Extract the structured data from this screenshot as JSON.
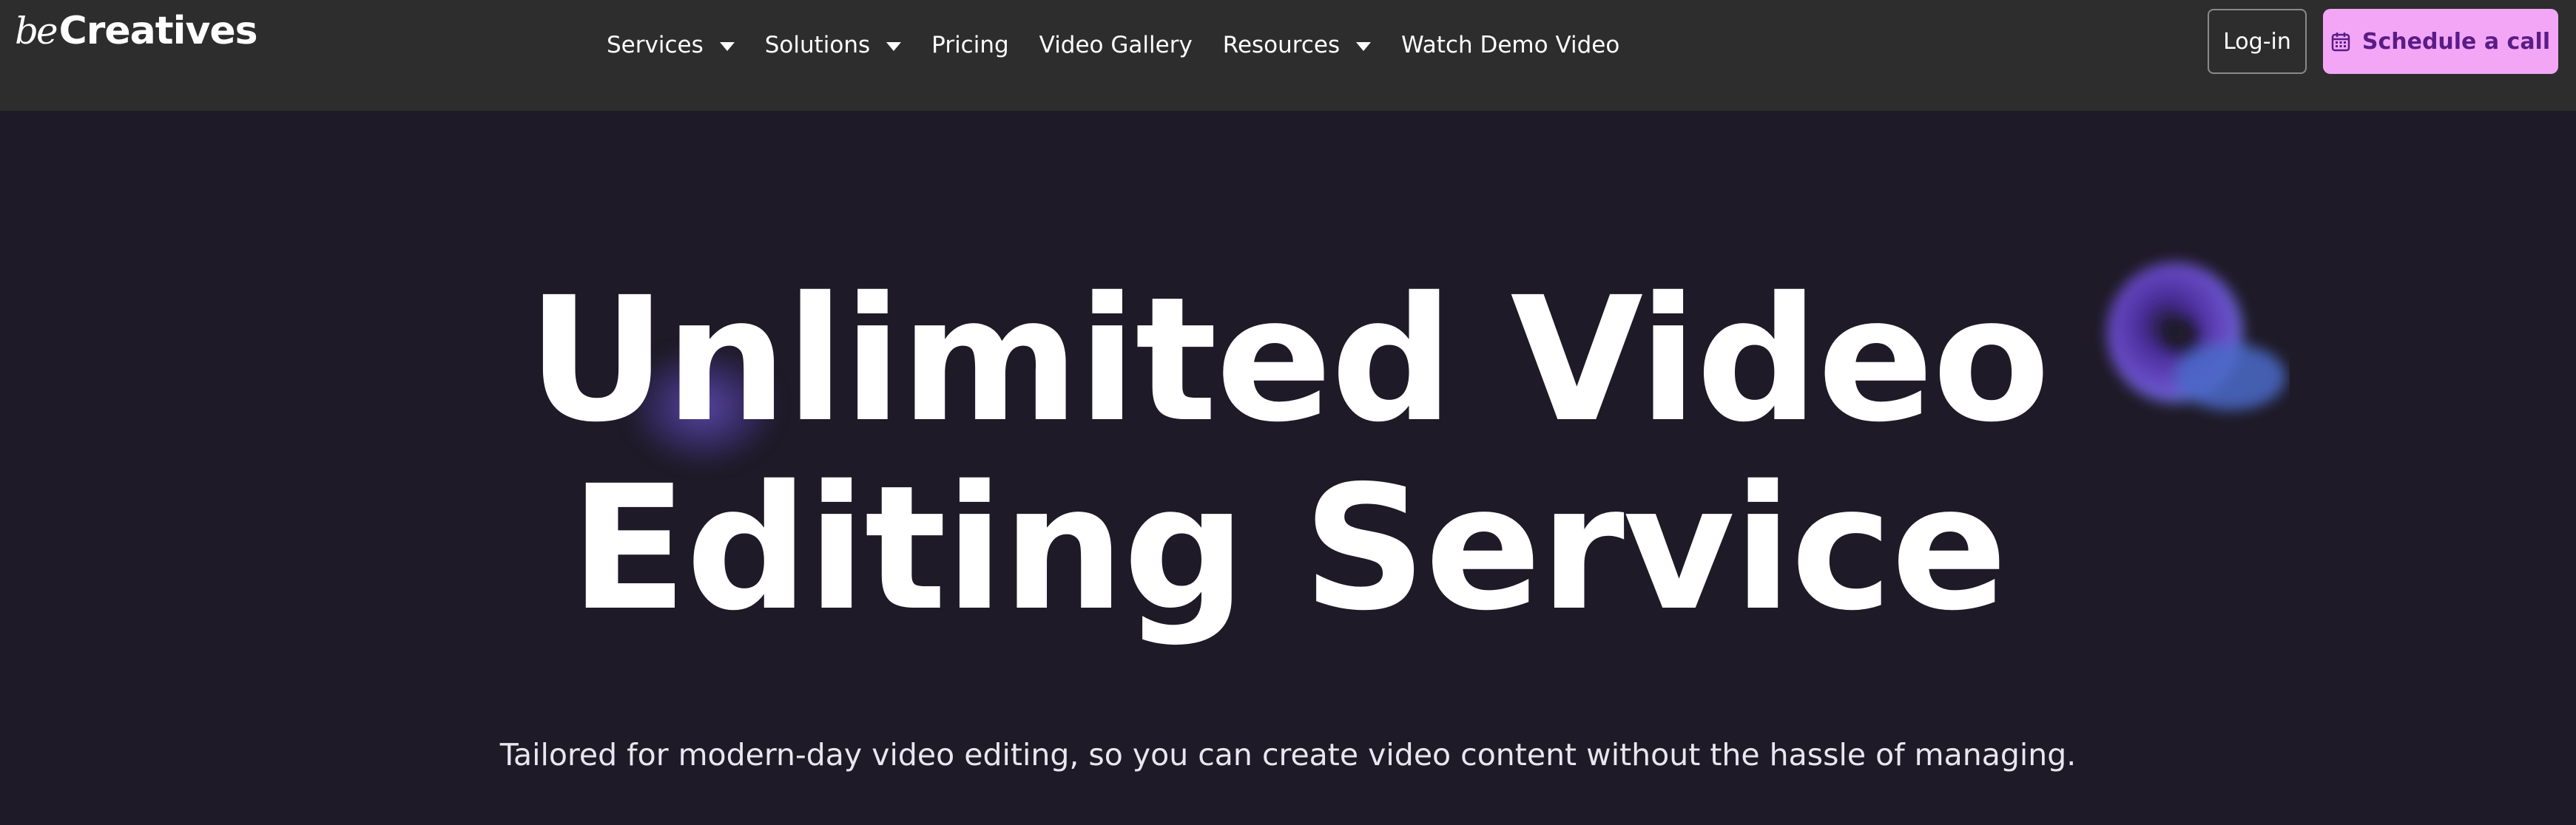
{
  "brand": {
    "logo_prefix": "be",
    "logo_name": "Creatives"
  },
  "nav": {
    "items": [
      {
        "label": "Services",
        "dropdown": true
      },
      {
        "label": "Solutions",
        "dropdown": true
      },
      {
        "label": "Pricing",
        "dropdown": false
      },
      {
        "label": "Video Gallery",
        "dropdown": false
      },
      {
        "label": "Resources",
        "dropdown": true
      },
      {
        "label": "Watch Demo Video",
        "dropdown": false
      }
    ]
  },
  "header_actions": {
    "login_label": "Log-in",
    "schedule_label": "Schedule a call",
    "schedule_icon": "calendar-icon"
  },
  "hero": {
    "title_line1": "Unlimited Video",
    "title_line2": "Editing Service",
    "subtitle": "Tailored for modern-day video editing, so you can create video content without the hassle of managing."
  },
  "colors": {
    "nav_background": "#2d2d2d",
    "page_background": "#1e1a27",
    "cta_background": "#f3a6f6",
    "cta_text": "#5a1c86"
  }
}
